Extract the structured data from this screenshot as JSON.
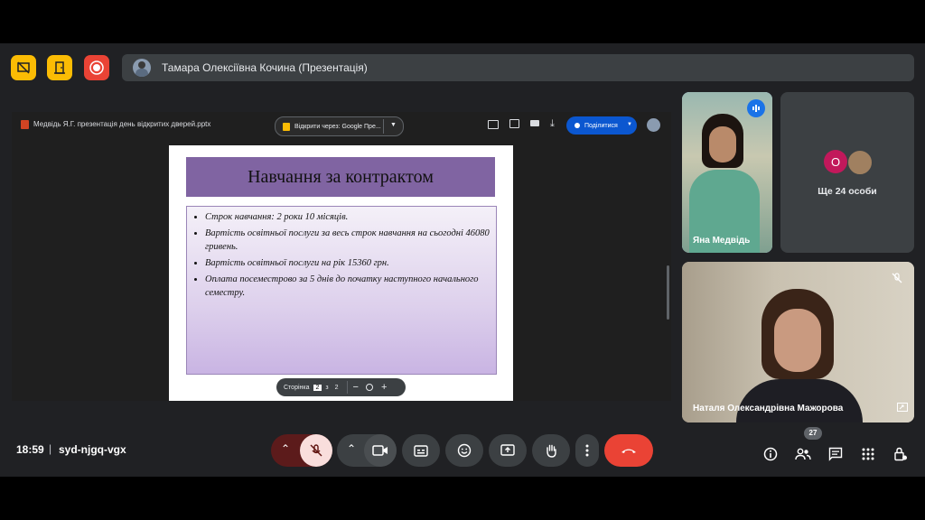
{
  "presenter": {
    "name": "Тамара Олексіївна Кочина (Презентація)"
  },
  "presentation": {
    "file_title": "Медвідь Я.Г. презентація день відкритих дверей.pptx",
    "open_with": "Відкрити через: Google Пре...",
    "share_label": "Поділитися",
    "slide": {
      "title": "Навчання за контрактом",
      "bullets": [
        "Строк навчання: 2 роки 10 місяців.",
        " Вартість освітньої послуги за весь строк навчання на сьогодні 46080 гривень.",
        "Вартість освітньої послуги на рік 15360 грн.",
        "Оплата посеместрово за 5 днів до початку наступного начального семестру."
      ]
    },
    "pager": {
      "label": "Сторінка",
      "current": "2",
      "of": "з",
      "total": "2"
    }
  },
  "participants": {
    "tile1_name": "Яна Медвідь",
    "more_label": "Ще 24 особи",
    "more_avatar_letter": "O",
    "tile3_name": "Наталя Олександрівна Мажорова"
  },
  "meeting": {
    "time": "18:59",
    "separator": "|",
    "code": "syd-njgq-vgx",
    "people_count": "27"
  },
  "colors": {
    "accent_blue": "#8ab4f8",
    "end_call": "#ea4335",
    "mic_off_bg": "#f9dedc",
    "host_yellow": "#fbbc04",
    "record_red": "#ea4335",
    "slide_title": "#8064a2"
  }
}
